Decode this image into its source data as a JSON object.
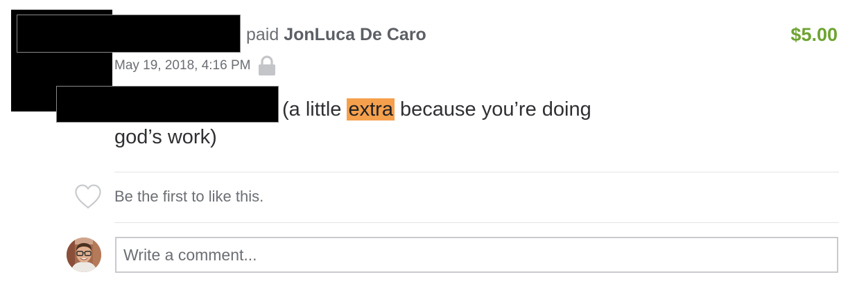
{
  "transaction": {
    "verb": "paid",
    "payee": "JonLuca De Caro",
    "amount": "$5.00",
    "date": "May 19, 2018, 4:16 PM",
    "privacy_icon": "lock-icon",
    "note_line1_before": "(a little ",
    "note_highlight": "extra",
    "note_line1_after": " because you’re doing",
    "note_line2": "god’s work)"
  },
  "likes": {
    "icon": "heart-icon",
    "text": "Be the first to like this."
  },
  "comment": {
    "placeholder": "Write a comment...",
    "value": ""
  },
  "colors": {
    "amount": "#6da331",
    "highlight": "#f5a04c",
    "redaction": "#000000"
  }
}
